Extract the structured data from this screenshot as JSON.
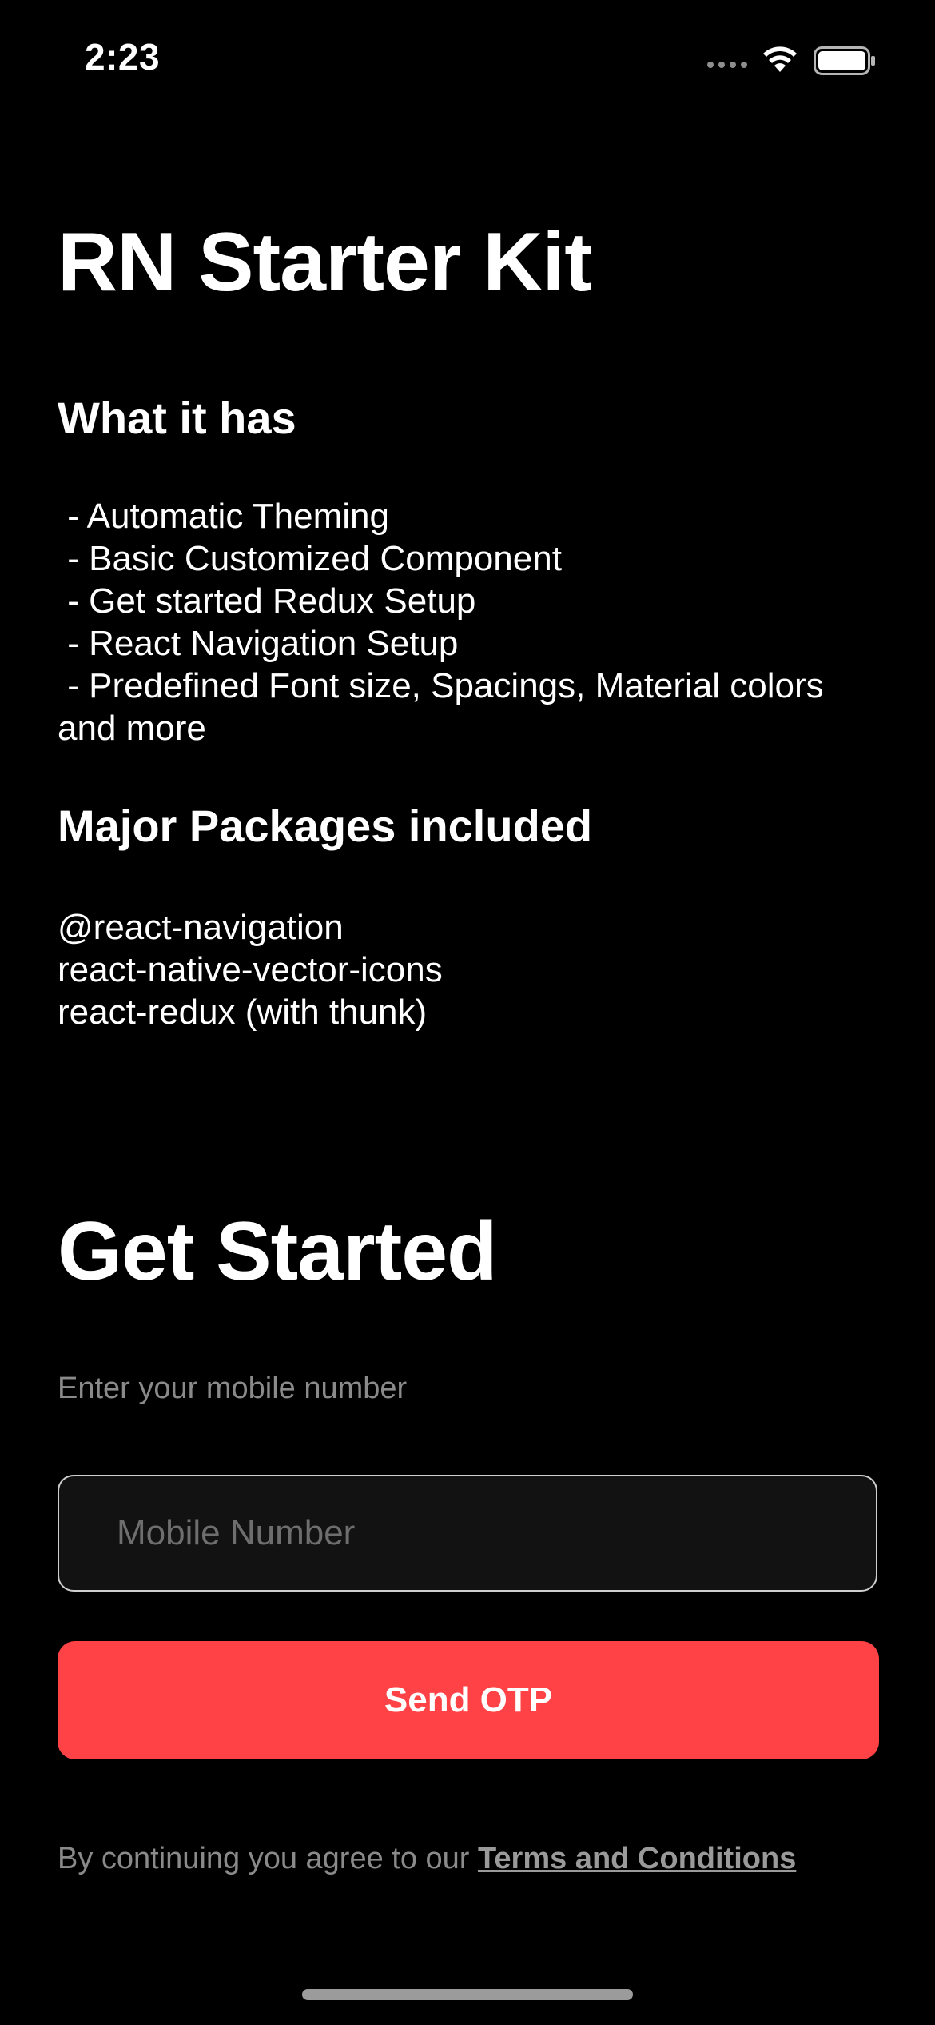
{
  "status_bar": {
    "time": "2:23",
    "icons": [
      "signal-dots-icon",
      "wifi-icon",
      "battery-icon"
    ]
  },
  "app": {
    "title": "RN Starter Kit"
  },
  "sections": {
    "what_it_has": {
      "heading": "What it has",
      "body": " - Automatic Theming\n - Basic Customized Component\n - Get started Redux Setup\n - React Navigation Setup\n - Predefined Font size, Spacings, Material colors and more"
    },
    "packages": {
      "heading": "Major Packages included",
      "body": "@react-navigation\nreact-native-vector-icons\nreact-redux (with thunk)"
    }
  },
  "get_started": {
    "title": "Get Started",
    "subtitle": "Enter your mobile number",
    "input": {
      "value": "",
      "placeholder": "Mobile Number"
    },
    "button_label": "Send OTP",
    "terms_prefix": "By continuing you agree to our ",
    "terms_link": "Terms and Conditions"
  },
  "colors": {
    "background": "#000000",
    "accent": "#ff4245",
    "muted_text": "#8a8a8a",
    "input_border": "#cfcfcf"
  }
}
